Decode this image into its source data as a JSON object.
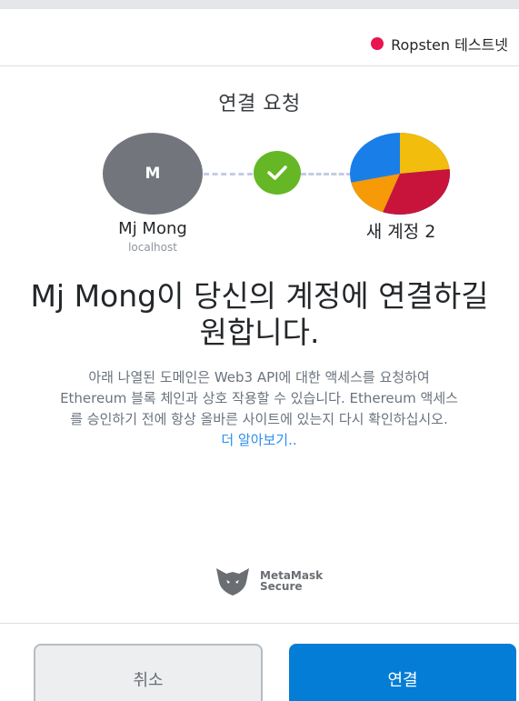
{
  "network": {
    "label": "Ropsten 테스트넷",
    "color": "#e91550"
  },
  "title": "연결 요청",
  "site": {
    "avatar_letter": "M",
    "name": "Mj Mong",
    "host": "localhost"
  },
  "connection_status_icon": "check-icon",
  "account": {
    "name": "새 계정 2",
    "identicon_colors": [
      "#f2bd0c",
      "#c8143a",
      "#f79a08",
      "#1a7ee8"
    ]
  },
  "headline": "Mj Mong이 당신의 계정에 연결하길 원합니다.",
  "description": "아래 나열된 도메인은 Web3 API에 대한 액세스를 요청하여 Ethereum 블록 체인과 상호 작용할 수 있습니다. Ethereum 액세스를 승인하기 전에 항상 올바른 사이트에 있는지 다시 확인하십시오.",
  "learn_more": "더 알아보기..",
  "secure_badge": {
    "line1": "MetaMask",
    "line2": "Secure"
  },
  "buttons": {
    "cancel": "취소",
    "connect": "연결"
  },
  "colors": {
    "primary": "#037dd6",
    "success": "#65b725",
    "link": "#2e8dee"
  }
}
